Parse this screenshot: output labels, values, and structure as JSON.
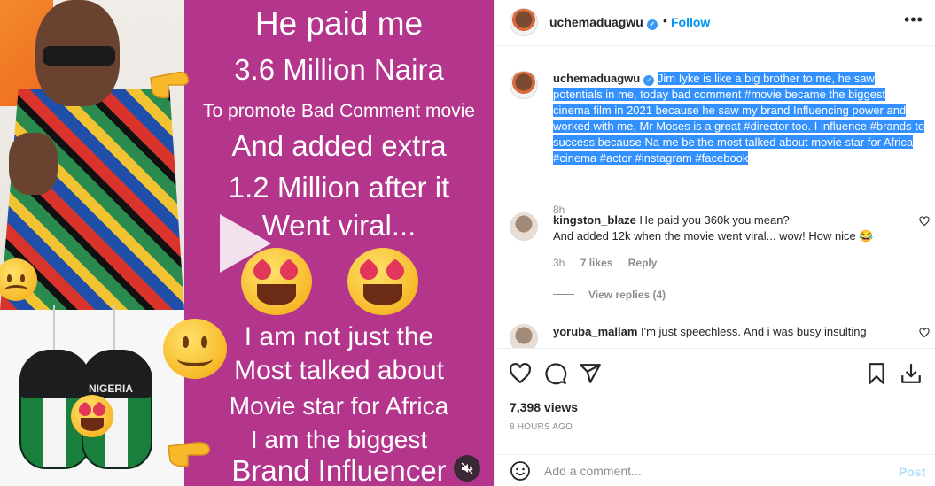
{
  "media": {
    "photo_caption_text": "NIGERIA",
    "poster_lines": [
      "He paid me",
      "3.6 Million Naira",
      "To promote Bad Comment movie",
      "And added extra",
      "1.2 Million after it",
      "Went viral...",
      "I am not just the",
      "Most talked about",
      "Movie star for Africa",
      "I am the biggest",
      "Brand Influencer"
    ],
    "poster_color": "#b3358c",
    "mute_icon": "muted-speaker-icon"
  },
  "header": {
    "username": "uchemaduagwu",
    "follow_label": "Follow",
    "separator": "•",
    "more_icon": "more-horizontal-icon"
  },
  "caption": {
    "username": "uchemaduagwu",
    "text": "Jim Iyke is like a big brother to me, he saw potentials in me, today bad comment #movie became the biggest cinema film in 2021 because he saw my brand Influencing power and worked with me, Mr Moses is a great #director too. I influence #brands to success because Na me be the most talked about movie star for Africa #cinema #actor #instagram #facebook",
    "time": "8h"
  },
  "comments": [
    {
      "username": "kingston_blaze",
      "text": "He paid you 360k you mean?",
      "text2": "And added 12k when the movie went viral... wow! How nice 😂",
      "time": "3h",
      "likes": "7 likes",
      "reply_label": "Reply",
      "view_replies": "View replies (4)"
    },
    {
      "username": "yoruba_mallam",
      "text": "I'm just speechless. And i was busy insulting"
    }
  ],
  "actions": {
    "views": "7,398 views",
    "posted_ago": "8 HOURS AGO"
  },
  "add_comment": {
    "placeholder": "Add a comment...",
    "post_label": "Post"
  },
  "colors": {
    "accent": "#0095f6",
    "highlight": "#3390ff",
    "muted_text": "#8e8e8e"
  }
}
